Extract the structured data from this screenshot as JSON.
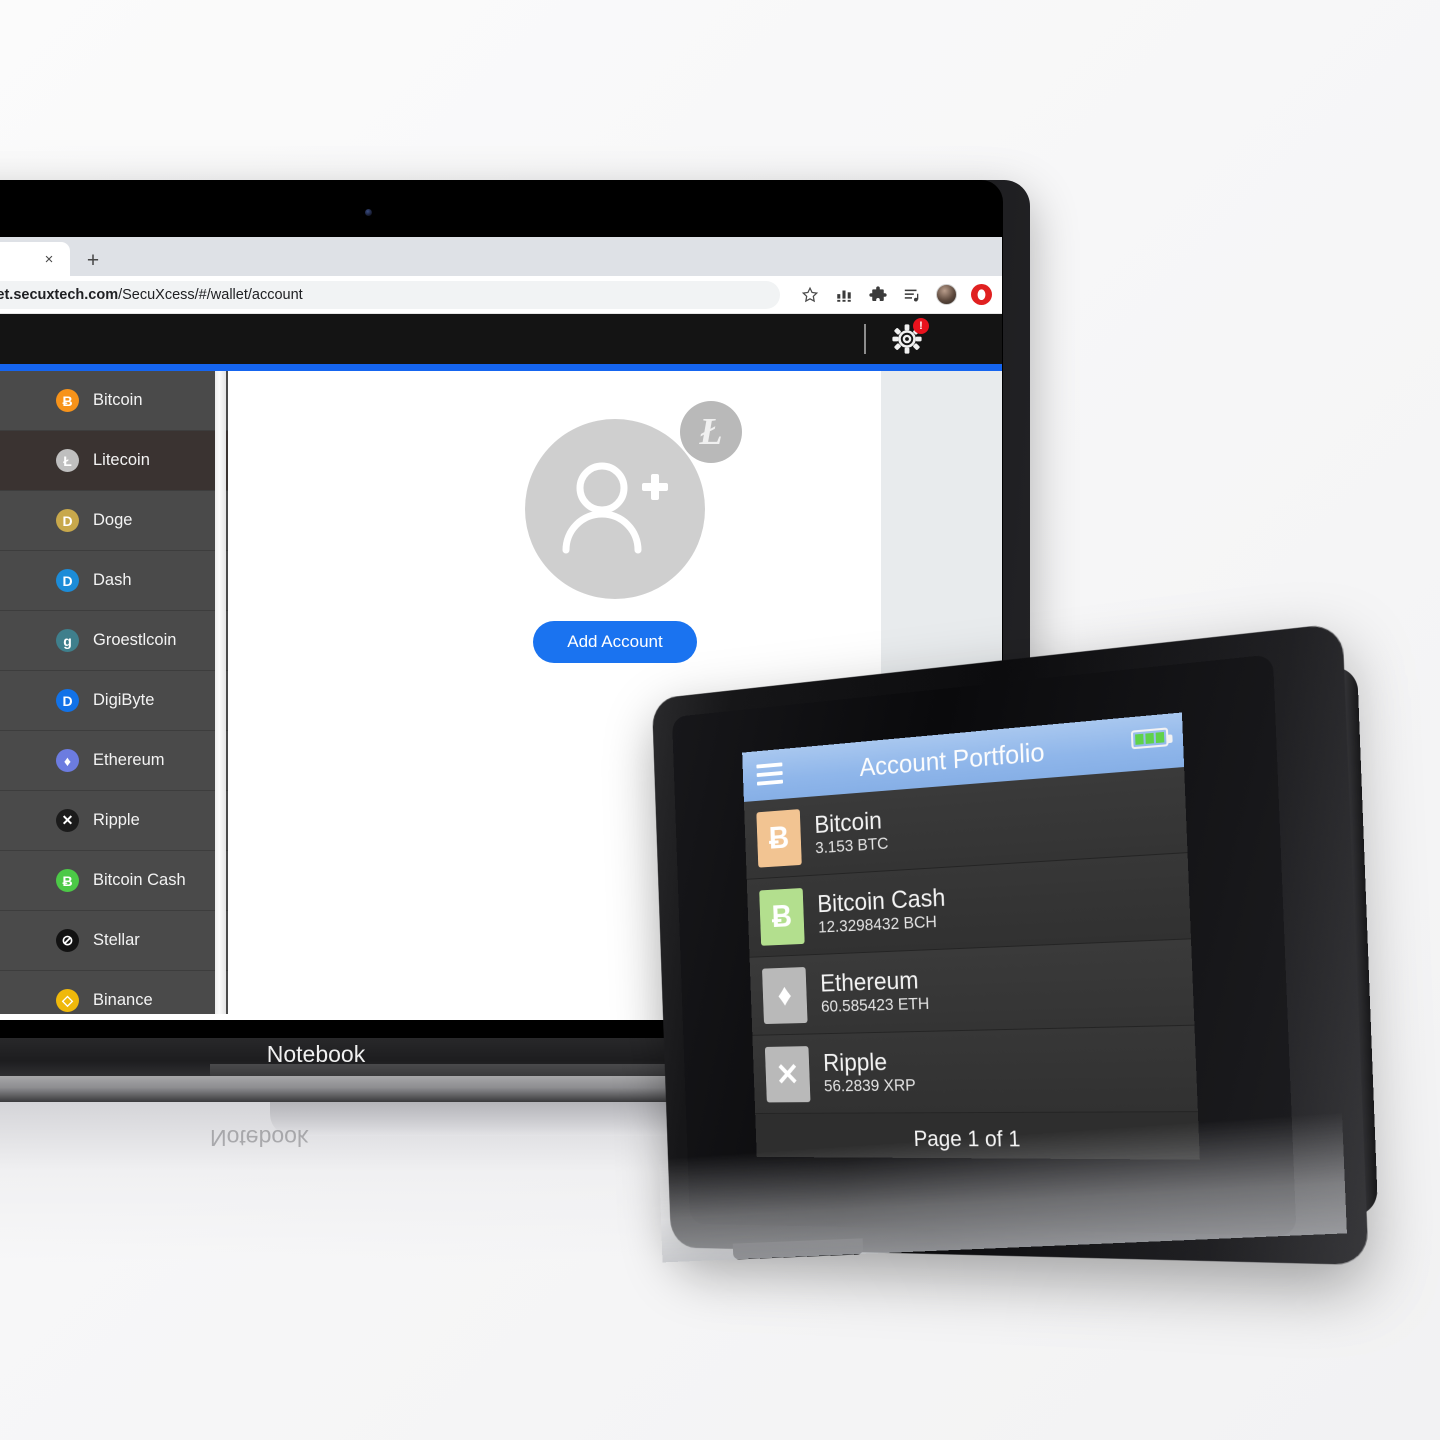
{
  "browser": {
    "tab_close_label": "×",
    "new_tab_label": "+",
    "url": "wallet.secuxtech.com/SecuXcess/#/wallet/account",
    "url_domain": "wallet.secuxtech.com",
    "url_path": "/SecuXcess/#/wallet/account",
    "icons": {
      "lock": "lock-icon",
      "bookmark": "star-icon",
      "analytics": "bar-chart-icon",
      "extensions": "puzzle-icon",
      "reading_list": "reading-list-icon",
      "profile": "avatar-icon",
      "opera": "opera-icon"
    }
  },
  "app_header": {
    "settings_label": "⚙",
    "badge_text": "!",
    "accent_color": "#1565f0"
  },
  "sidebar": {
    "items": [
      {
        "label": "Bitcoin",
        "symbol": "Ƀ",
        "color": "#f7931a",
        "text_color": "#ffffff",
        "active": false
      },
      {
        "label": "Litecoin",
        "symbol": "Ł",
        "color": "#bfbfbf",
        "text_color": "#ffffff",
        "active": true
      },
      {
        "label": "Doge",
        "symbol": "D",
        "color": "#c8a84b",
        "text_color": "#ffffff",
        "active": false
      },
      {
        "label": "Dash",
        "symbol": "D",
        "color": "#1c8cd8",
        "text_color": "#ffffff",
        "active": false
      },
      {
        "label": "Groestlcoin",
        "symbol": "g",
        "color": "#3f7f8c",
        "text_color": "#ffffff",
        "active": false
      },
      {
        "label": "DigiByte",
        "symbol": "D",
        "color": "#1272e8",
        "text_color": "#ffffff",
        "active": false
      },
      {
        "label": "Ethereum",
        "symbol": "♦",
        "color": "#6c7ce0",
        "text_color": "#ffffff",
        "active": false
      },
      {
        "label": "Ripple",
        "symbol": "✕",
        "color": "#1b1b1b",
        "text_color": "#ffffff",
        "active": false
      },
      {
        "label": "Bitcoin Cash",
        "symbol": "Ƀ",
        "color": "#4cc947",
        "text_color": "#ffffff",
        "active": false
      },
      {
        "label": "Stellar",
        "symbol": "⊘",
        "color": "#121212",
        "text_color": "#ffffff",
        "active": false
      },
      {
        "label": "Binance",
        "symbol": "◇",
        "color": "#f0b90b",
        "text_color": "#ffffff",
        "active": false
      }
    ]
  },
  "content": {
    "avatar_icon": "add-person-icon",
    "coin_badge": "Ł",
    "coin_badge_name": "litecoin-badge-icon",
    "add_account_label": "Add Account",
    "button_color": "#1a73f0"
  },
  "laptop": {
    "brand_label": "Notebook",
    "reflection_label": "Notebook"
  },
  "device": {
    "title": "Account Portfolio",
    "menu_icon": "hamburger-menu-icon",
    "battery_icon": "battery-icon",
    "battery_color": "#5fd24a",
    "accounts": [
      {
        "name": "Bitcoin",
        "amount": "3.153 BTC",
        "symbol": "Ƀ",
        "tile_color": "#f2c492",
        "glyph_color": "#ffffff"
      },
      {
        "name": "Bitcoin Cash",
        "amount": "12.3298432 BCH",
        "symbol": "Ƀ",
        "tile_color": "#b3df8e",
        "glyph_color": "#ffffff"
      },
      {
        "name": "Ethereum",
        "amount": "60.585423 ETH",
        "symbol": "♦",
        "tile_color": "#b9b9b9",
        "glyph_color": "#ffffff"
      },
      {
        "name": "Ripple",
        "amount": "56.2839 XRP",
        "symbol": "✕",
        "tile_color": "#b9b9b9",
        "glyph_color": "#ffffff"
      }
    ],
    "page_label": "Page 1 of 1"
  }
}
